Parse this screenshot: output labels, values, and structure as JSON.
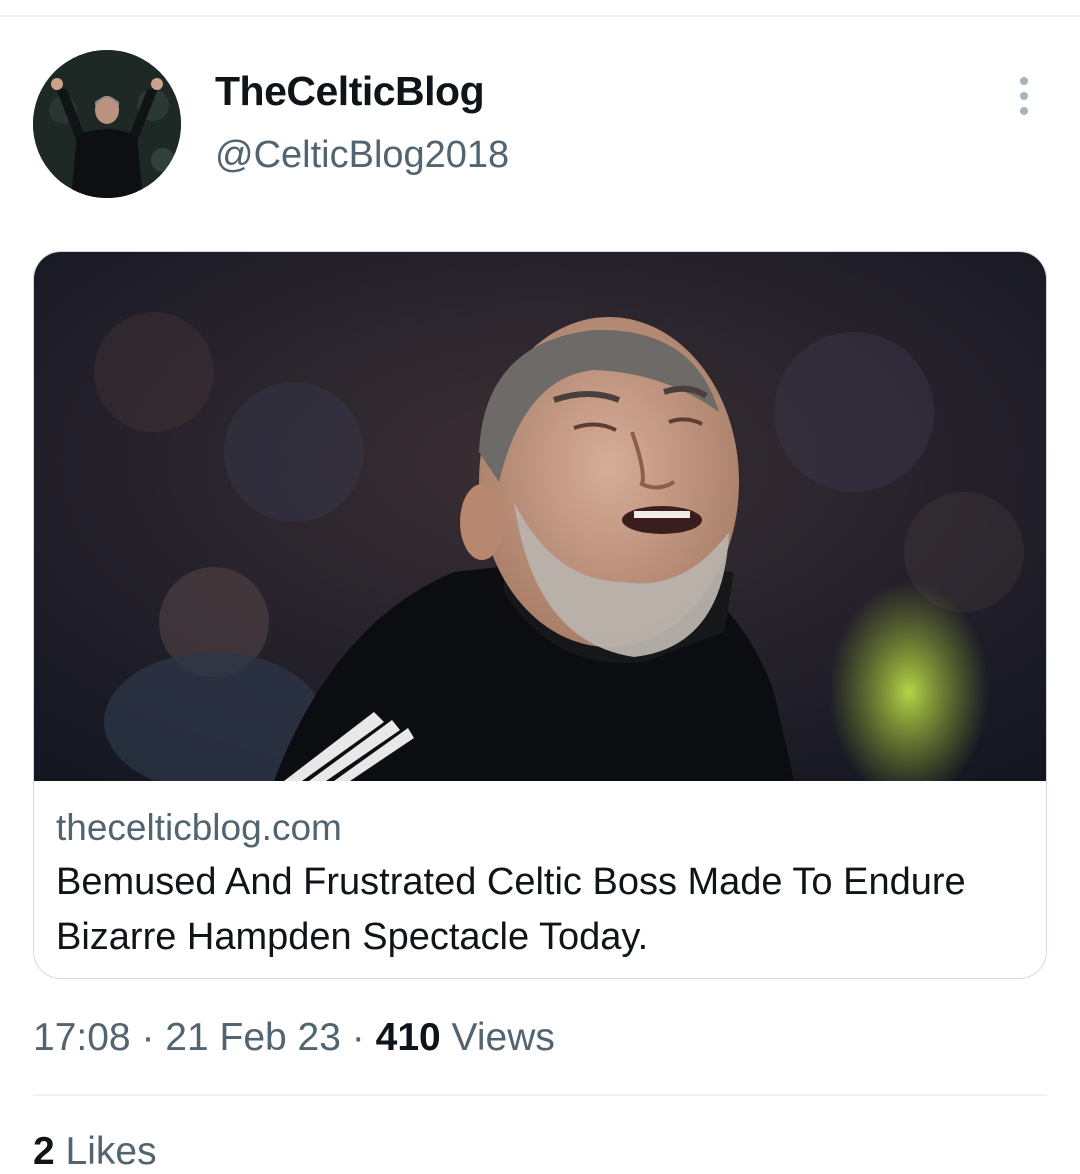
{
  "tweet": {
    "author": {
      "display_name": "TheCelticBlog",
      "handle": "@CelticBlog2018"
    },
    "more_icon": "more-vertical-icon",
    "link_card": {
      "domain": "thecelticblog.com",
      "title": "Bemused And Frustrated Celtic Boss Made To Endure Bizarre Hampden Spectacle Today."
    },
    "meta": {
      "time": "17:08",
      "separator": "·",
      "date": "21 Feb 23",
      "views_count": "410",
      "views_label": "Views"
    },
    "engagement": {
      "likes_count": "2",
      "likes_label": "Likes"
    }
  },
  "colors": {
    "primary_text": "#0f1419",
    "secondary_text": "#536471",
    "border": "#cfd9de",
    "divider": "#eff3f4"
  }
}
